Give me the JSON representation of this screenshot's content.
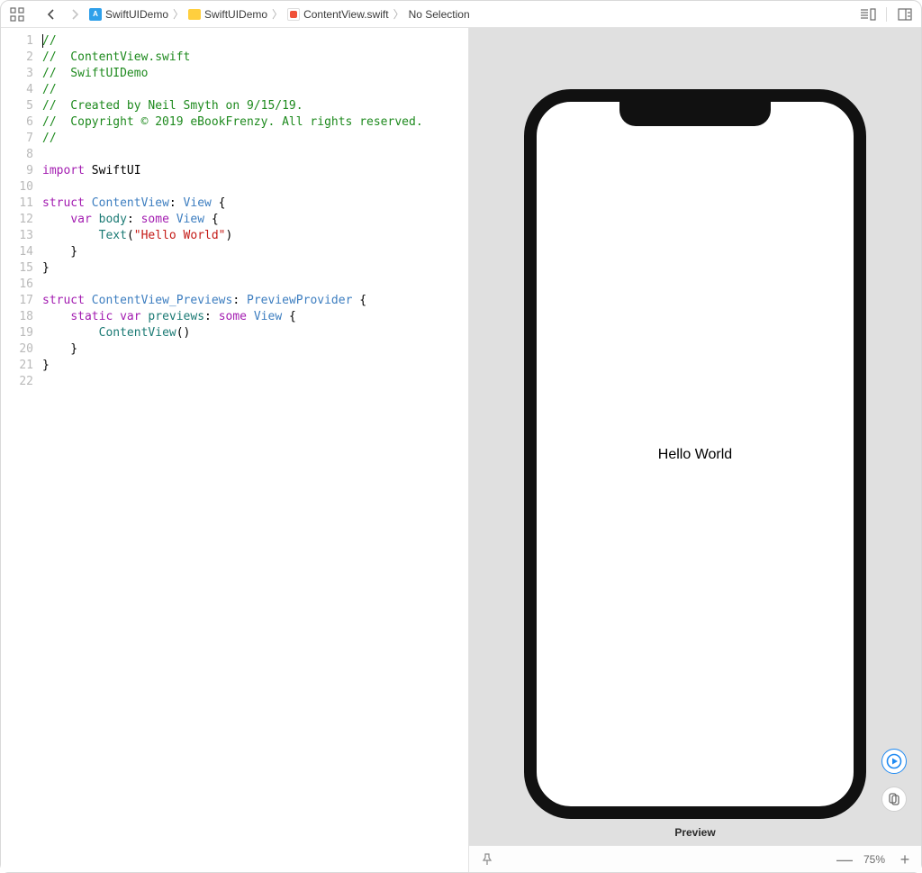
{
  "breadcrumb": {
    "project": "SwiftUIDemo",
    "folder": "SwiftUIDemo",
    "file": "ContentView.swift",
    "selection": "No Selection"
  },
  "code": {
    "lines": [
      {
        "n": 1,
        "segments": [
          {
            "cls": "c-comment",
            "t": "//"
          }
        ],
        "hasCursor": true
      },
      {
        "n": 2,
        "segments": [
          {
            "cls": "c-comment",
            "t": "//  ContentView.swift"
          }
        ]
      },
      {
        "n": 3,
        "segments": [
          {
            "cls": "c-comment",
            "t": "//  SwiftUIDemo"
          }
        ]
      },
      {
        "n": 4,
        "segments": [
          {
            "cls": "c-comment",
            "t": "//"
          }
        ]
      },
      {
        "n": 5,
        "segments": [
          {
            "cls": "c-comment",
            "t": "//  Created by Neil Smyth on 9/15/19."
          }
        ]
      },
      {
        "n": 6,
        "segments": [
          {
            "cls": "c-comment",
            "t": "//  Copyright © 2019 eBookFrenzy. All rights reserved."
          }
        ]
      },
      {
        "n": 7,
        "segments": [
          {
            "cls": "c-comment",
            "t": "//"
          }
        ]
      },
      {
        "n": 8,
        "segments": [
          {
            "cls": "",
            "t": ""
          }
        ]
      },
      {
        "n": 9,
        "segments": [
          {
            "cls": "c-keyword",
            "t": "import"
          },
          {
            "cls": "",
            "t": " SwiftUI"
          }
        ]
      },
      {
        "n": 10,
        "segments": [
          {
            "cls": "",
            "t": ""
          }
        ]
      },
      {
        "n": 11,
        "segments": [
          {
            "cls": "c-keyword",
            "t": "struct"
          },
          {
            "cls": "",
            "t": " "
          },
          {
            "cls": "c-type",
            "t": "ContentView"
          },
          {
            "cls": "",
            "t": ": "
          },
          {
            "cls": "c-type",
            "t": "View"
          },
          {
            "cls": "",
            "t": " {"
          }
        ]
      },
      {
        "n": 12,
        "segments": [
          {
            "cls": "",
            "t": "    "
          },
          {
            "cls": "c-keyword",
            "t": "var"
          },
          {
            "cls": "",
            "t": " "
          },
          {
            "cls": "c-type2",
            "t": "body"
          },
          {
            "cls": "",
            "t": ": "
          },
          {
            "cls": "c-keyword",
            "t": "some"
          },
          {
            "cls": "",
            "t": " "
          },
          {
            "cls": "c-type",
            "t": "View"
          },
          {
            "cls": "",
            "t": " {"
          }
        ]
      },
      {
        "n": 13,
        "segments": [
          {
            "cls": "",
            "t": "        "
          },
          {
            "cls": "c-type2",
            "t": "Text"
          },
          {
            "cls": "",
            "t": "("
          },
          {
            "cls": "c-string",
            "t": "\"Hello World\""
          },
          {
            "cls": "",
            "t": ")"
          }
        ]
      },
      {
        "n": 14,
        "segments": [
          {
            "cls": "",
            "t": "    }"
          }
        ]
      },
      {
        "n": 15,
        "segments": [
          {
            "cls": "",
            "t": "}"
          }
        ]
      },
      {
        "n": 16,
        "segments": [
          {
            "cls": "",
            "t": ""
          }
        ]
      },
      {
        "n": 17,
        "segments": [
          {
            "cls": "c-keyword",
            "t": "struct"
          },
          {
            "cls": "",
            "t": " "
          },
          {
            "cls": "c-type",
            "t": "ContentView_Previews"
          },
          {
            "cls": "",
            "t": ": "
          },
          {
            "cls": "c-type",
            "t": "PreviewProvider"
          },
          {
            "cls": "",
            "t": " {"
          }
        ]
      },
      {
        "n": 18,
        "segments": [
          {
            "cls": "",
            "t": "    "
          },
          {
            "cls": "c-keyword",
            "t": "static"
          },
          {
            "cls": "",
            "t": " "
          },
          {
            "cls": "c-keyword",
            "t": "var"
          },
          {
            "cls": "",
            "t": " "
          },
          {
            "cls": "c-type2",
            "t": "previews"
          },
          {
            "cls": "",
            "t": ": "
          },
          {
            "cls": "c-keyword",
            "t": "some"
          },
          {
            "cls": "",
            "t": " "
          },
          {
            "cls": "c-type",
            "t": "View"
          },
          {
            "cls": "",
            "t": " {"
          }
        ]
      },
      {
        "n": 19,
        "segments": [
          {
            "cls": "",
            "t": "        "
          },
          {
            "cls": "c-type2",
            "t": "ContentView"
          },
          {
            "cls": "",
            "t": "()"
          }
        ]
      },
      {
        "n": 20,
        "segments": [
          {
            "cls": "",
            "t": "    }"
          }
        ]
      },
      {
        "n": 21,
        "segments": [
          {
            "cls": "",
            "t": "}"
          }
        ]
      },
      {
        "n": 22,
        "segments": [
          {
            "cls": "",
            "t": ""
          }
        ]
      }
    ]
  },
  "preview": {
    "deviceText": "Hello World",
    "label": "Preview",
    "zoom": "75%"
  }
}
